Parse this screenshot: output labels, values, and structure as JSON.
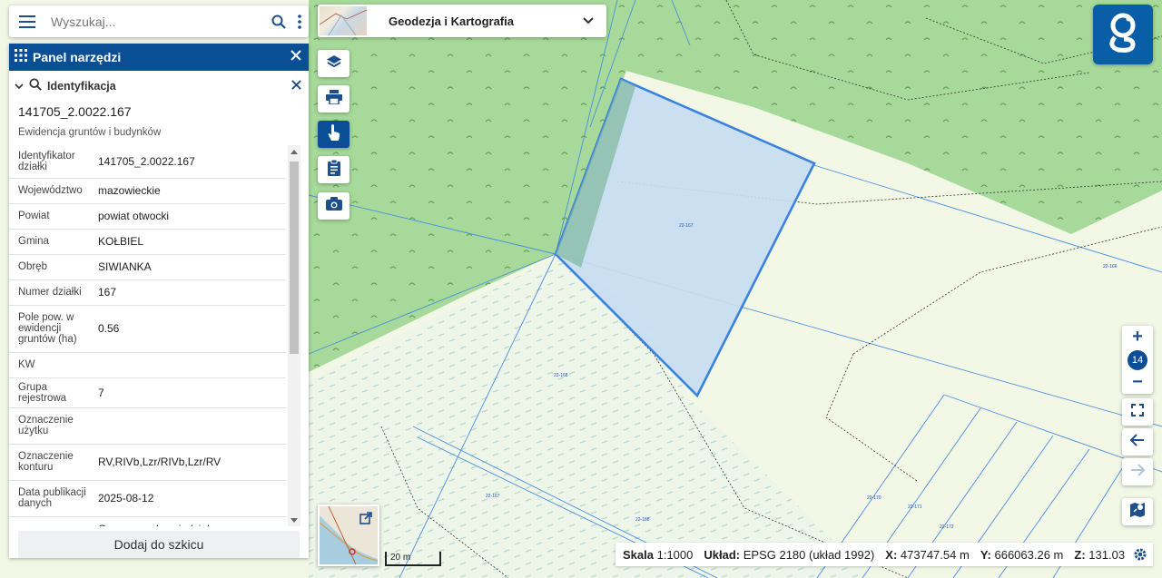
{
  "search": {
    "placeholder": "Wyszukaj..."
  },
  "layer": {
    "title": "Geodezja i Kartografia"
  },
  "panel": {
    "title": "Panel narzędzi",
    "section": "Identyfikacja",
    "parcel_id": "141705_2.0022.167",
    "layer_name": "Ewidencja gruntów i budynków",
    "rows": [
      {
        "key": "Identyfikator działki",
        "value": "141705_2.0022.167"
      },
      {
        "key": "Województwo",
        "value": "mazowieckie"
      },
      {
        "key": "Powiat",
        "value": "powiat otwocki"
      },
      {
        "key": "Gmina",
        "value": "KOŁBIEL"
      },
      {
        "key": "Obręb",
        "value": "SIWIANKA"
      },
      {
        "key": "Numer działki",
        "value": "167"
      },
      {
        "key": "Pole pow. w ewidencji gruntów (ha)",
        "value": "0.56"
      },
      {
        "key": "KW",
        "value": ""
      },
      {
        "key": "Grupa rejestrowa",
        "value": "7"
      },
      {
        "key": "Oznaczenie użytku",
        "value": ""
      },
      {
        "key": "Oznaczenie konturu",
        "value": "RV,RIVb,Lzr/RIVb,Lzr/RV"
      },
      {
        "key": "Data publikacji danych",
        "value": "2025-08-12"
      },
      {
        "key": "",
        "value": "Organem odpowiedzialnym za"
      }
    ],
    "sketch_button": "Dodaj do szkicu"
  },
  "map": {
    "scalebar": "20 m",
    "parcel_labels": [
      "22-167",
      "22-166",
      "22-168",
      "22-167",
      "22-168",
      "22-170",
      "22-171",
      "22-172"
    ]
  },
  "zoom": {
    "plus": "+",
    "level": "14",
    "minus": "−"
  },
  "status": {
    "scale_label": "Skala",
    "scale_value": "1:1000",
    "crs_label": "Układ:",
    "crs_value": "EPSG 2180 (układ 1992)",
    "x_label": "X:",
    "x_value": "473747.54 m",
    "y_label": "Y:",
    "y_value": "666063.26 m",
    "z_label": "Z:",
    "z_value": "131.03"
  },
  "icons": {
    "menu": "menu-icon",
    "search": "search-icon",
    "more": "more-vert-icon",
    "layers": "layers-icon",
    "print": "print-icon",
    "identify": "hand-pointer-icon",
    "clipboard": "clipboard-icon",
    "camera": "camera-icon"
  },
  "colors": {
    "brand": "#0a4f96",
    "logo": "#0a5ea8",
    "forest": "#a6d99a",
    "meadow": "#eef6dc",
    "parcel_fill": "#c7ddf2",
    "parcel_stroke": "#3b82e0"
  }
}
